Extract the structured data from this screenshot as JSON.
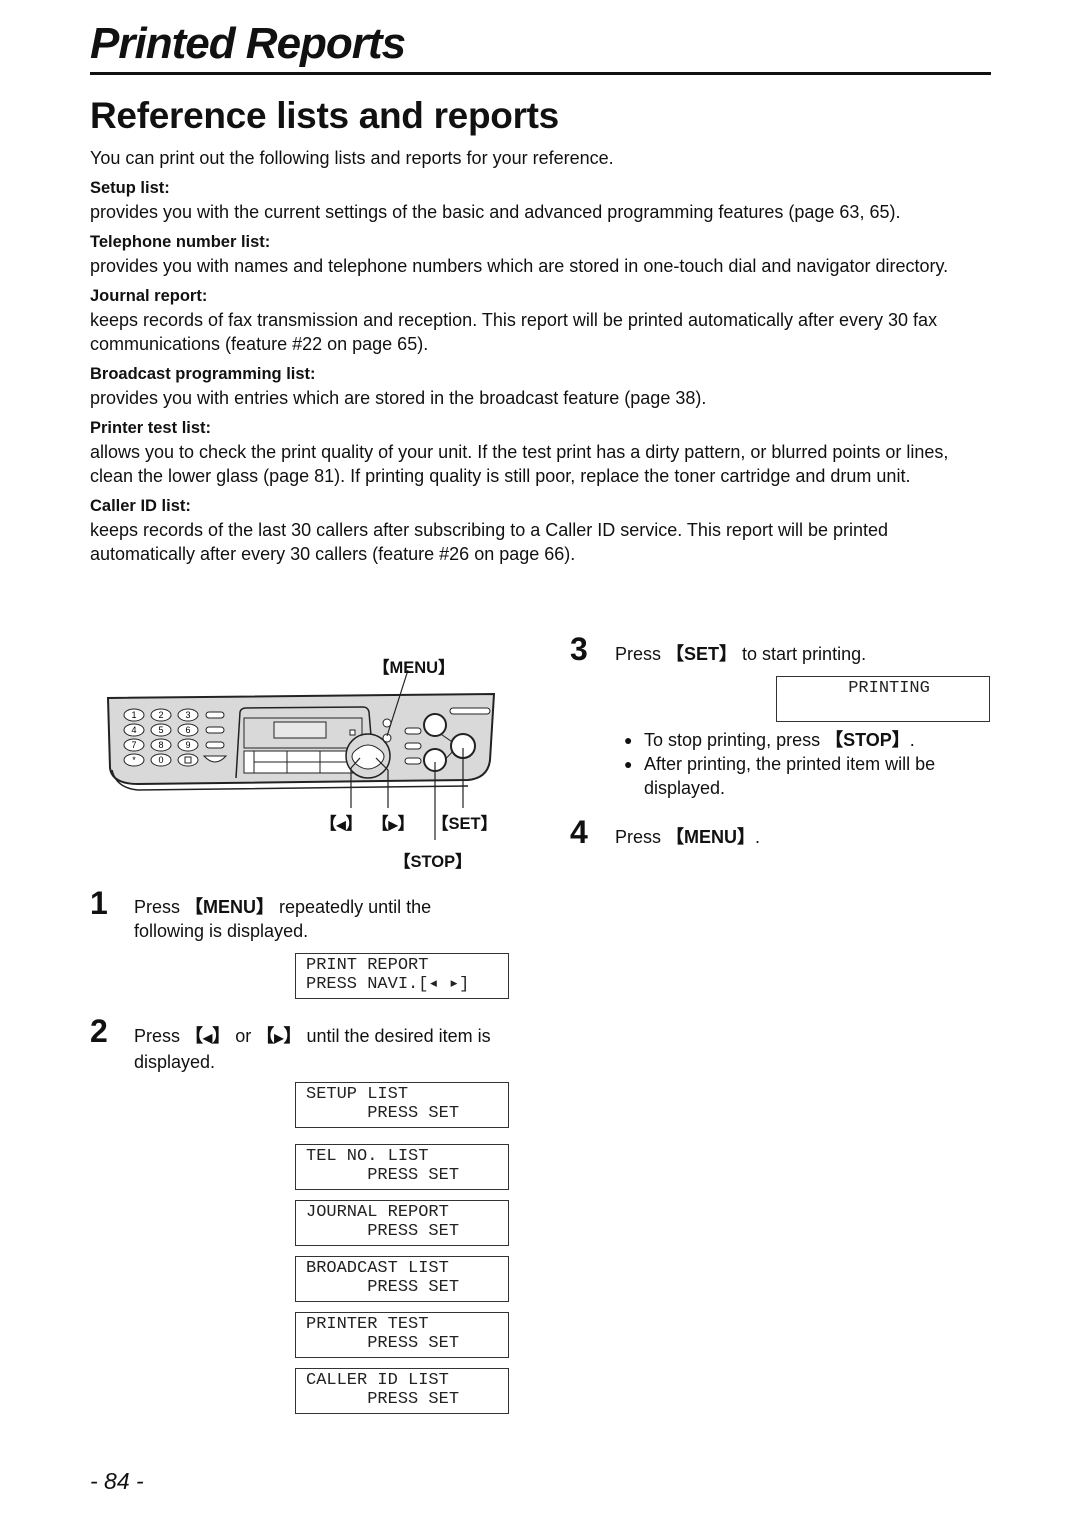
{
  "header": {
    "chapter_title": "Printed Reports"
  },
  "section": {
    "title": "Reference lists and reports",
    "intro": "You can print out the following lists and reports for your reference."
  },
  "definitions": [
    {
      "term": "Setup list:",
      "description": "provides you with the current settings of the basic and advanced programming features (page 63, 65)."
    },
    {
      "term": "Telephone number list:",
      "description": "provides you with names and telephone numbers which are stored in one-touch dial and navigator directory."
    },
    {
      "term": "Journal report:",
      "description": "keeps records of fax transmission and reception. This report will be printed automatically after every 30 fax communications (feature #22 on page 65)."
    },
    {
      "term": "Broadcast programming list:",
      "description": "provides you with entries which are stored in the broadcast feature (page 38)."
    },
    {
      "term": "Printer test list:",
      "description": "allows you to check the print quality of your unit. If the test print has a dirty pattern, or blurred points or lines, clean the lower glass (page 81). If printing quality is still poor, replace the toner cartridge and drum unit."
    },
    {
      "term": "Caller ID list:",
      "description": "keeps records of the last 30 callers after subscribing to a Caller ID service. This report will be printed automatically after every 30 callers (feature #26 on page 66)."
    }
  ],
  "panel": {
    "callouts": {
      "menu": "MENU",
      "left": "◀",
      "right": "▶",
      "set": "SET",
      "stop": "STOP"
    },
    "keypad": [
      "1",
      "2",
      "3",
      "4",
      "5",
      "6",
      "7",
      "8",
      "9",
      "*",
      "0",
      "#"
    ]
  },
  "steps": [
    {
      "number": "1",
      "text_before": "Press ",
      "key": "MENU",
      "text_after": " repeatedly until the following is displayed.",
      "displays": [
        {
          "line1": "PRINT REPORT",
          "line2": "PRESS NAVI.[◂ ▸]"
        }
      ]
    },
    {
      "number": "2",
      "text_before": "Press ",
      "key": "◀",
      "text_middle": " or ",
      "key2": "▶",
      "text_after": " until the desired item is displayed.",
      "displays": [
        {
          "line1": "SETUP LIST",
          "line2": "      PRESS SET"
        },
        {
          "line1": "TEL NO. LIST",
          "line2": "      PRESS SET"
        },
        {
          "line1": "JOURNAL REPORT",
          "line2": "      PRESS SET"
        },
        {
          "line1": "BROADCAST LIST",
          "line2": "      PRESS SET"
        },
        {
          "line1": "PRINTER TEST",
          "line2": "      PRESS SET"
        },
        {
          "line1": "CALLER ID LIST",
          "line2": "      PRESS SET"
        }
      ]
    },
    {
      "number": "3",
      "text_before": "Press ",
      "key": "SET",
      "text_after": " to start printing.",
      "displays": [
        {
          "line1": "      PRINTING",
          "line2": ""
        }
      ],
      "bullets": [
        {
          "text_before": "To stop printing, press ",
          "key": "STOP",
          "text_after": "."
        },
        {
          "text_before": "After printing, the printed item will be displayed.",
          "key": "",
          "text_after": ""
        }
      ]
    },
    {
      "number": "4",
      "text_before": "Press ",
      "key": "MENU",
      "text_after": "."
    }
  ],
  "footer": {
    "page_number": "- 84 -"
  }
}
